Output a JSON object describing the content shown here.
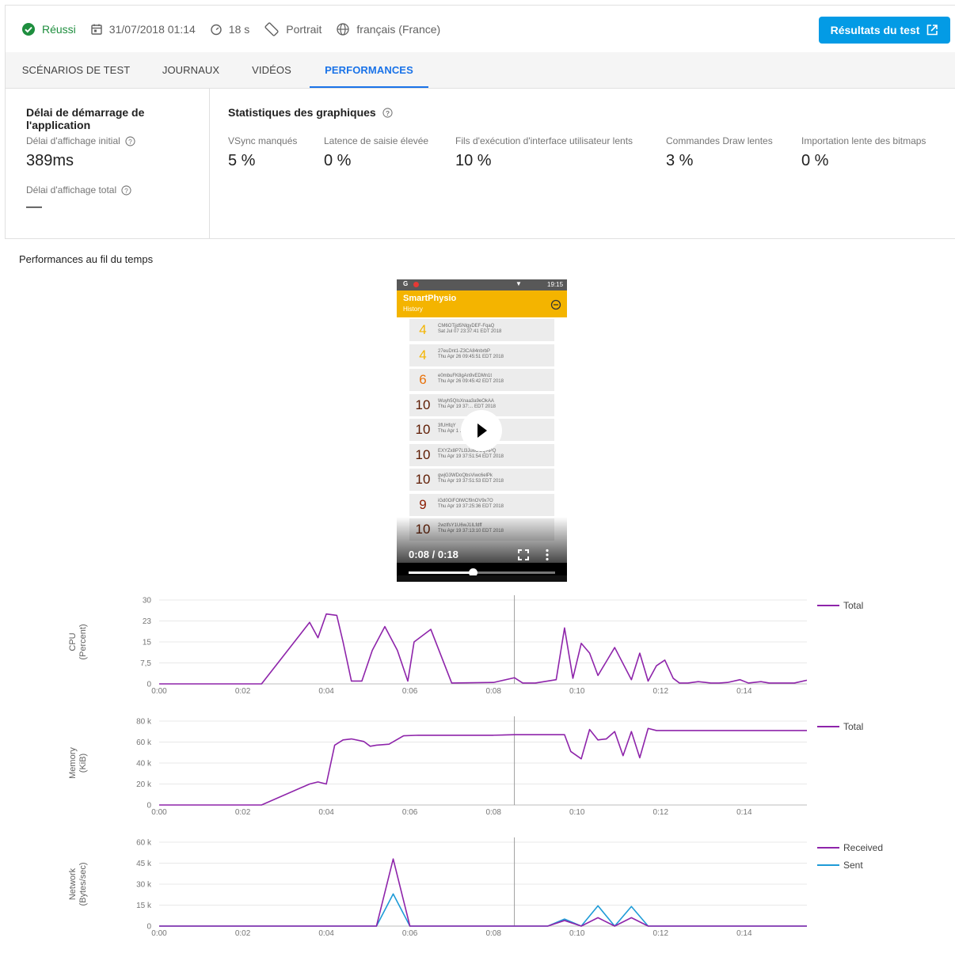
{
  "header": {
    "status": "Réussi",
    "datetime": "31/07/2018 01:14",
    "duration": "18 s",
    "orientation": "Portrait",
    "locale": "français (France)",
    "results_button": "Résultats du test",
    "status_color": "#1e8e3e",
    "button_color": "#039be5"
  },
  "tabs": [
    {
      "label": "SCÉNARIOS DE TEST",
      "active": false
    },
    {
      "label": "JOURNAUX",
      "active": false
    },
    {
      "label": "VIDÉOS",
      "active": false
    },
    {
      "label": "PERFORMANCES",
      "active": true
    }
  ],
  "startup": {
    "title": "Délai de démarrage de l'application",
    "initial_label": "Délai d'affichage initial",
    "initial_value": "389ms",
    "total_label": "Délai d'affichage total",
    "total_value": "—"
  },
  "graphics": {
    "title": "Statistiques des graphiques",
    "stats": [
      {
        "label": "VSync manqués",
        "value": "5 %"
      },
      {
        "label": "Latence de saisie élevée",
        "value": "0 %"
      },
      {
        "label": "Fils d'exécution d'interface utilisateur lents",
        "value": "10 %"
      },
      {
        "label": "Commandes Draw lentes",
        "value": "3 %"
      },
      {
        "label": "Importation lente des bitmaps",
        "value": "0 %"
      }
    ]
  },
  "over_time_title": "Performances au fil du temps",
  "video": {
    "app_name": "SmartPhysio",
    "screen_title": "History",
    "status_time": "19:15",
    "time": "0:08 / 0:18",
    "progress": 0.44,
    "rows": [
      {
        "score": "4",
        "line1": "CM6OTjjd5NlgyDEF-FqaQ",
        "line2": "Sat Jul 07 23:37:41 EDT 2018",
        "color": "#f4b400"
      },
      {
        "score": "4",
        "line1": "27euDnt1-Z3CA84nbrbP",
        "line2": "Thu Apr 26 09:45:51 EDT 2018",
        "color": "#f4b400"
      },
      {
        "score": "6",
        "line1": "e0mbuFK8gAn9vEDMn1t",
        "line2": "Thu Apr 26 09:45:42 EDT 2018",
        "color": "#e8710a"
      },
      {
        "score": "10",
        "line1": "Wuyh5QIsXnaa3a9eOkAA",
        "line2": "Thu Apr 19 37:... EDT 2018",
        "color": "#5d1a00"
      },
      {
        "score": "10",
        "line1": "3fUHfqY",
        "line2": "Thu Apr 1 ... 2018",
        "color": "#5d1a00"
      },
      {
        "score": "10",
        "line1": "EXYZx8P7Ll3Ju6OCQAPQ",
        "line2": "Thu Apr 19 37:51:54 EDT 2018",
        "color": "#5d1a00"
      },
      {
        "score": "10",
        "line1": "gwjG3WDoQbsViwc6elPk",
        "line2": "Thu Apr 19 37:51:53 EDT 2018",
        "color": "#5d1a00"
      },
      {
        "score": "9",
        "line1": "iGd0OiFOlWCf9nOV9x7O",
        "line2": "Thu Apr 19 37:25:36 EDT 2018",
        "color": "#8b1a00"
      },
      {
        "score": "10",
        "line1": "2wzlfsY1U6wJ1ILfdff",
        "line2": "Thu Apr 19 37:13:10 EDT 2018",
        "color": "#5d1a00"
      }
    ]
  },
  "chart_data": [
    {
      "type": "line",
      "ylabel": "CPU",
      "yunit": "(Percent)",
      "ytick_labels": [
        "0",
        "7,5",
        "15",
        "23",
        "30"
      ],
      "ylim": [
        0,
        30
      ],
      "xlim": [
        0,
        15.5
      ],
      "xtick_labels": [
        "0:00",
        "0:02",
        "0:04",
        "0:06",
        "0:08",
        "0:10",
        "0:12",
        "0:14"
      ],
      "cursor": 8.5,
      "legend": [
        {
          "name": "Total",
          "color": "#8e24aa"
        }
      ],
      "series": [
        {
          "name": "Total",
          "color": "#8e24aa",
          "x": [
            0,
            2.45,
            3.6,
            3.8,
            4.0,
            4.25,
            4.4,
            4.6,
            4.85,
            5.1,
            5.4,
            5.7,
            5.95,
            6.1,
            6.5,
            7.0,
            8.0,
            8.5,
            8.7,
            9.0,
            9.5,
            9.7,
            9.9,
            10.1,
            10.3,
            10.5,
            10.7,
            10.9,
            11.3,
            11.5,
            11.7,
            11.9,
            12.1,
            12.3,
            12.45,
            12.65,
            12.9,
            13.2,
            13.4,
            13.6,
            13.9,
            14.1,
            14.4,
            14.6,
            14.9,
            15.2,
            15.5
          ],
          "values": [
            0,
            0,
            22,
            16.5,
            25,
            24.5,
            15,
            1,
            1,
            12,
            20.5,
            12,
            1,
            15,
            19.5,
            0.3,
            0.5,
            2.2,
            0.3,
            0.3,
            1.5,
            20,
            2,
            14.5,
            11,
            3,
            8,
            13,
            1.5,
            11,
            1,
            6.5,
            8.5,
            2,
            0.3,
            0.3,
            0.8,
            0.3,
            0.3,
            0.5,
            1.5,
            0.3,
            0.8,
            0.3,
            0.3,
            0.3,
            1.3
          ]
        }
      ]
    },
    {
      "type": "line",
      "ylabel": "Memory",
      "yunit": "(KiB)",
      "ytick_labels": [
        "0",
        "20 k",
        "40 k",
        "60 k",
        "80 k"
      ],
      "ylim": [
        0,
        80000
      ],
      "xlim": [
        0,
        15.5
      ],
      "xtick_labels": [
        "0:00",
        "0:02",
        "0:04",
        "0:06",
        "0:08",
        "0:10",
        "0:12",
        "0:14"
      ],
      "cursor": 8.5,
      "legend": [
        {
          "name": "Total",
          "color": "#8e24aa"
        }
      ],
      "series": [
        {
          "name": "Total",
          "color": "#8e24aa",
          "x": [
            0,
            2.45,
            3.6,
            3.8,
            4.0,
            4.2,
            4.4,
            4.6,
            4.9,
            5.05,
            5.2,
            5.5,
            5.85,
            6.2,
            7.0,
            8.0,
            8.5,
            9.0,
            9.7,
            9.85,
            10.1,
            10.3,
            10.5,
            10.7,
            10.9,
            11.1,
            11.3,
            11.5,
            11.7,
            11.9,
            12.1,
            12.3,
            12.6,
            13.0,
            14.0,
            15.5
          ],
          "values": [
            0,
            0,
            20000,
            22000,
            20000,
            57000,
            62000,
            63000,
            60500,
            56000,
            57000,
            58000,
            66000,
            66500,
            66500,
            66500,
            67000,
            67000,
            67000,
            51000,
            44000,
            72000,
            62000,
            63000,
            70000,
            47000,
            70000,
            45000,
            73000,
            71000,
            71000,
            71000,
            71000,
            71000,
            71000,
            71000
          ]
        }
      ]
    },
    {
      "type": "line",
      "ylabel": "Network",
      "yunit": "(Bytes/sec)",
      "ytick_labels": [
        "0",
        "15 k",
        "30 k",
        "45 k",
        "60 k"
      ],
      "ylim": [
        0,
        60000
      ],
      "xlim": [
        0,
        15.5
      ],
      "xtick_labels": [
        "0:00",
        "0:02",
        "0:04",
        "0:06",
        "0:08",
        "0:10",
        "0:12",
        "0:14"
      ],
      "cursor": 8.5,
      "legend": [
        {
          "name": "Received",
          "color": "#8e24aa"
        },
        {
          "name": "Sent",
          "color": "#1e9bd7"
        }
      ],
      "series": [
        {
          "name": "Received",
          "color": "#8e24aa",
          "x": [
            0,
            5.2,
            5.6,
            6.0,
            9.3,
            9.7,
            10.1,
            10.5,
            10.9,
            11.3,
            11.7,
            12.1,
            15.5
          ],
          "values": [
            0,
            0,
            48000,
            0,
            0,
            4000,
            0,
            6000,
            0,
            6000,
            0,
            0,
            0
          ]
        },
        {
          "name": "Sent",
          "color": "#1e9bd7",
          "x": [
            0,
            5.2,
            5.6,
            6.0,
            9.3,
            9.7,
            10.1,
            10.5,
            10.9,
            11.3,
            11.7,
            12.1,
            15.5
          ],
          "values": [
            0,
            0,
            23000,
            0,
            0,
            5000,
            0,
            14500,
            0,
            14000,
            0,
            0,
            0
          ]
        }
      ]
    }
  ]
}
